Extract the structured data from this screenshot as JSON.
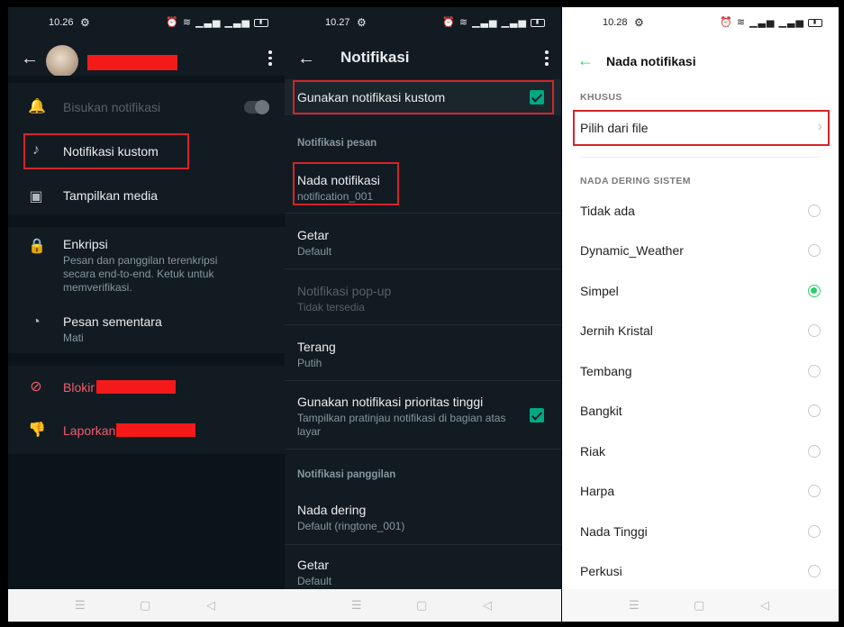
{
  "colors": {
    "dark_bg": "#121b22",
    "accent_green": "#00a884",
    "danger": "#f15c6d",
    "highlight_box": "#d5242a",
    "radio_selected": "#2bcf73"
  },
  "panel1": {
    "status": {
      "time": "10.26"
    },
    "rows": {
      "mute": "Bisukan notifikasi",
      "custom_notif": "Notifikasi kustom",
      "show_media": "Tampilkan media",
      "encryption_title": "Enkripsi",
      "encryption_sub": "Pesan dan panggilan terenkripsi secara end-to-end. Ketuk untuk memverifikasi.",
      "disappearing_title": "Pesan sementara",
      "disappearing_sub": "Mati",
      "block": "Blokir",
      "report": "Laporkan"
    }
  },
  "panel2": {
    "status": {
      "time": "10.27"
    },
    "title": "Notifikasi",
    "use_custom": "Gunakan notifikasi kustom",
    "section_messages": "Notifikasi pesan",
    "tone_title": "Nada notifikasi",
    "tone_sub": "notification_001",
    "vibrate_title": "Getar",
    "vibrate_sub": "Default",
    "popup_title": "Notifikasi pop-up",
    "popup_sub": "Tidak tersedia",
    "light_title": "Terang",
    "light_sub": "Putih",
    "priority_title": "Gunakan notifikasi prioritas tinggi",
    "priority_sub": "Tampilkan pratinjau notifikasi di bagian atas layar",
    "section_calls": "Notifikasi panggilan",
    "ringtone_title": "Nada dering",
    "ringtone_sub": "Default (ringtone_001)",
    "call_vibrate_title": "Getar",
    "call_vibrate_sub": "Default"
  },
  "panel3": {
    "status": {
      "time": "10.28"
    },
    "title": "Nada notifikasi",
    "section_custom": "KHUSUS",
    "pick_file": "Pilih dari file",
    "section_system": "NADA DERING SISTEM",
    "tones": [
      "Tidak ada",
      "Dynamic_Weather",
      "Simpel",
      "Jernih Kristal",
      "Tembang",
      "Bangkit",
      "Riak",
      "Harpa",
      "Nada Tinggi",
      "Perkusi"
    ],
    "selected_tone": "Simpel"
  }
}
